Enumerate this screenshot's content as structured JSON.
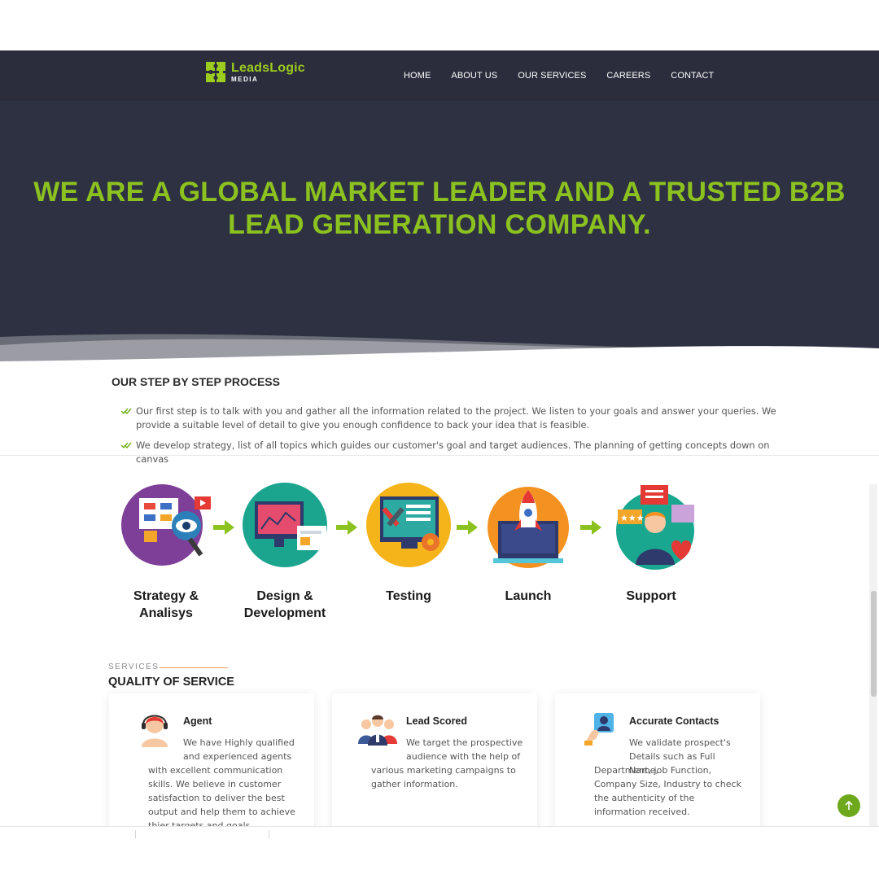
{
  "brand": {
    "name": "LeadsLogic",
    "sub": "MEDIA",
    "accent": "#8cc21f"
  },
  "nav": {
    "items": [
      "HOME",
      "ABOUT US",
      "OUR SERVICES",
      "CAREERS",
      "CONTACT"
    ]
  },
  "hero": {
    "title": "WE ARE A GLOBAL MARKET LEADER AND A TRUSTED B2B\nLEAD GENERATION COMPANY."
  },
  "process": {
    "heading": "OUR STEP BY STEP PROCESS",
    "items": [
      "Our first step is to talk with you and gather all the information related to the project. We listen to your goals and answer your queries. We provide a suitable level of detail to give you enough confidence to back your idea that is feasible.",
      "We develop strategy, list of all topics which guides our customer's goal and target audiences. The planning of getting concepts down on canvas"
    ],
    "steps": [
      {
        "label": "Strategy &\nAnalisys",
        "icon": "strategy-icon"
      },
      {
        "label": "Design &\nDevelopment",
        "icon": "design-icon"
      },
      {
        "label": "Testing",
        "icon": "testing-icon"
      },
      {
        "label": "Launch",
        "icon": "launch-icon"
      },
      {
        "label": "Support",
        "icon": "support-icon"
      }
    ]
  },
  "services": {
    "eyebrow": "SERVICES",
    "title": "QUALITY OF SERVICE",
    "cards": [
      {
        "title": "Agent",
        "icon": "agent-icon",
        "text_a": "We have Highly qualified and experienced agents",
        "text_b": "with excellent communication skills. We believe in customer satisfaction to deliver the best output and help them to achieve thier targets and goals."
      },
      {
        "title": "Lead Scored",
        "icon": "team-icon",
        "text_a": "We target the prospective audience with the help of",
        "text_b": "various marketing campaigns to gather information."
      },
      {
        "title": "Accurate Contacts",
        "icon": "contact-card-icon",
        "text_a": "We validate prospect's Details such as Full Name,",
        "text_b": "Department, job Function, Company Size, Industry to check the authenticity of the information received."
      }
    ]
  }
}
